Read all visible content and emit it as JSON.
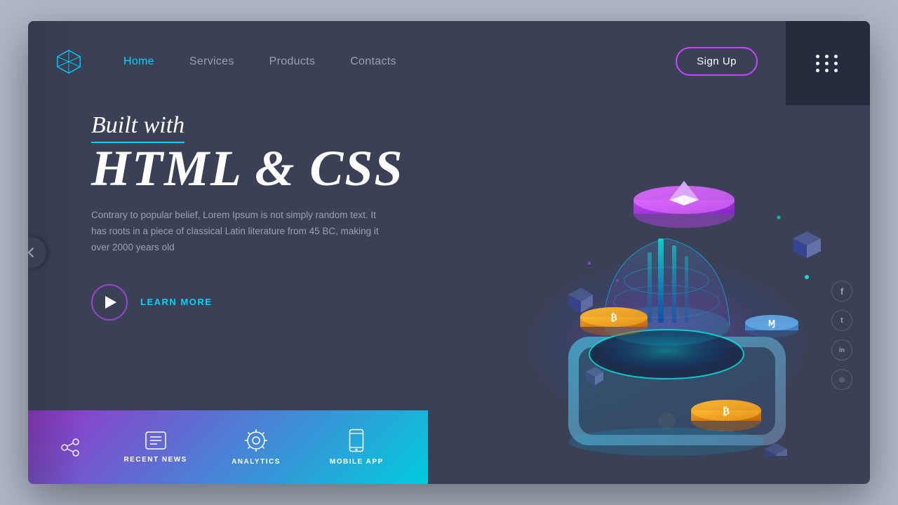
{
  "screen": {
    "title": "Built with HTML & CSS"
  },
  "navbar": {
    "logo_alt": "Diamond Logo",
    "links": [
      {
        "label": "Home",
        "active": true
      },
      {
        "label": "Services",
        "active": false
      },
      {
        "label": "Products",
        "active": false
      },
      {
        "label": "Contacts",
        "active": false
      }
    ],
    "signup_label": "Sign Up"
  },
  "hero": {
    "subtitle": "Built with",
    "title": "HTML & CSS",
    "description": "Contrary to popular belief, Lorem Ipsum is not simply random text. It has roots in a piece of classical Latin literature from 45 BC, making it over 2000 years old",
    "cta_label": "LEARN MORE"
  },
  "bottom_bar": {
    "items": [
      {
        "label": "RECENT NEWS",
        "icon": "💬"
      },
      {
        "label": "ANALYTICS",
        "icon": "⚙"
      },
      {
        "label": "MOBILE APP",
        "icon": "📱"
      }
    ]
  },
  "social": {
    "items": [
      {
        "label": "facebook",
        "icon": "f"
      },
      {
        "label": "twitter",
        "icon": "t"
      },
      {
        "label": "linkedin",
        "icon": "in"
      },
      {
        "label": "instagram",
        "icon": "ig"
      }
    ]
  },
  "left_arrow": "›",
  "dots_label": "menu-grid"
}
